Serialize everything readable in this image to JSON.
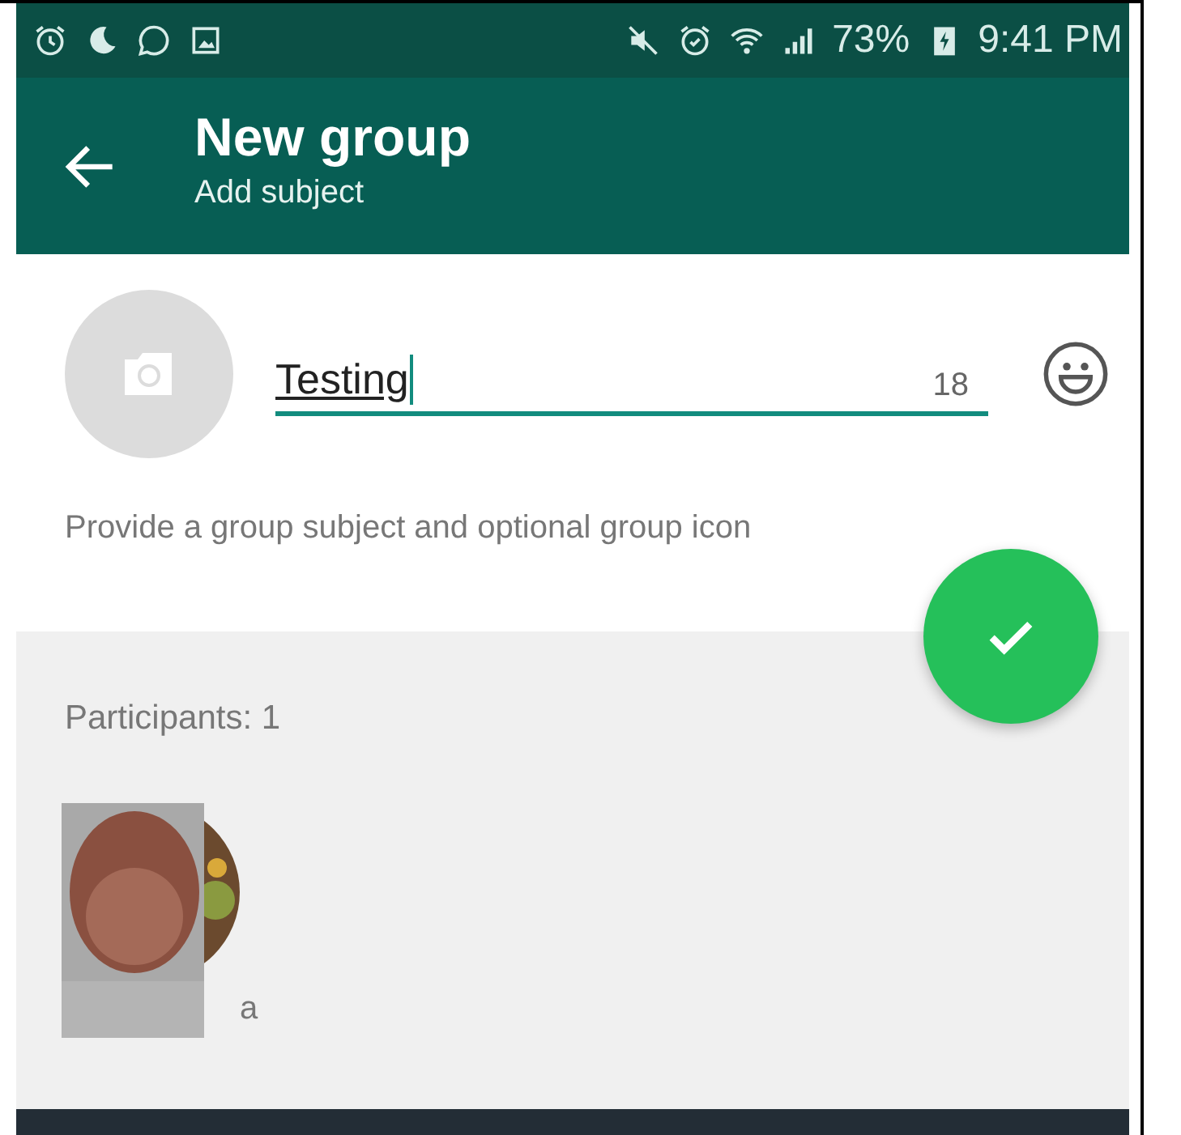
{
  "status_bar": {
    "battery": "73%",
    "time": "9:41 PM"
  },
  "app_bar": {
    "title": "New group",
    "subtitle": "Add subject"
  },
  "subject": {
    "value": "Testing",
    "counter": "18",
    "hint": "Provide a group subject and optional group icon"
  },
  "participants": {
    "label": "Participants: 1",
    "items": [
      {
        "name": "a",
        "kind": "picture"
      }
    ]
  }
}
